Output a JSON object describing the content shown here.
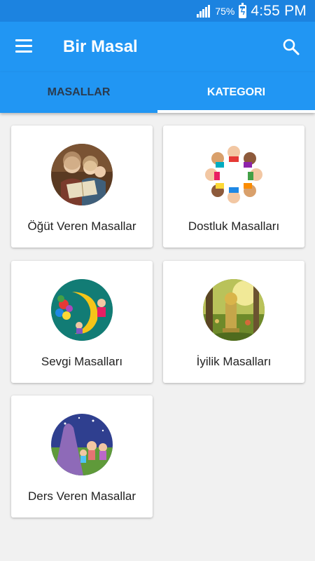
{
  "status": {
    "battery_percent": "75%",
    "time": "4:55 PM"
  },
  "app": {
    "title": "Bir Masal"
  },
  "tabs": [
    {
      "label": "MASALLAR"
    },
    {
      "label": "KATEGORI"
    }
  ],
  "categories": [
    {
      "label": "Öğüt Veren Masallar"
    },
    {
      "label": "Dostluk Masalları"
    },
    {
      "label": "Sevgi Masalları"
    },
    {
      "label": "İyilik Masalları"
    },
    {
      "label": "Ders Veren Masallar"
    }
  ],
  "colors": {
    "primary": "#2196f3",
    "status_bar": "#1c83e0",
    "background": "#f1f1f1",
    "inactive_tab": "#2a3b4f"
  }
}
